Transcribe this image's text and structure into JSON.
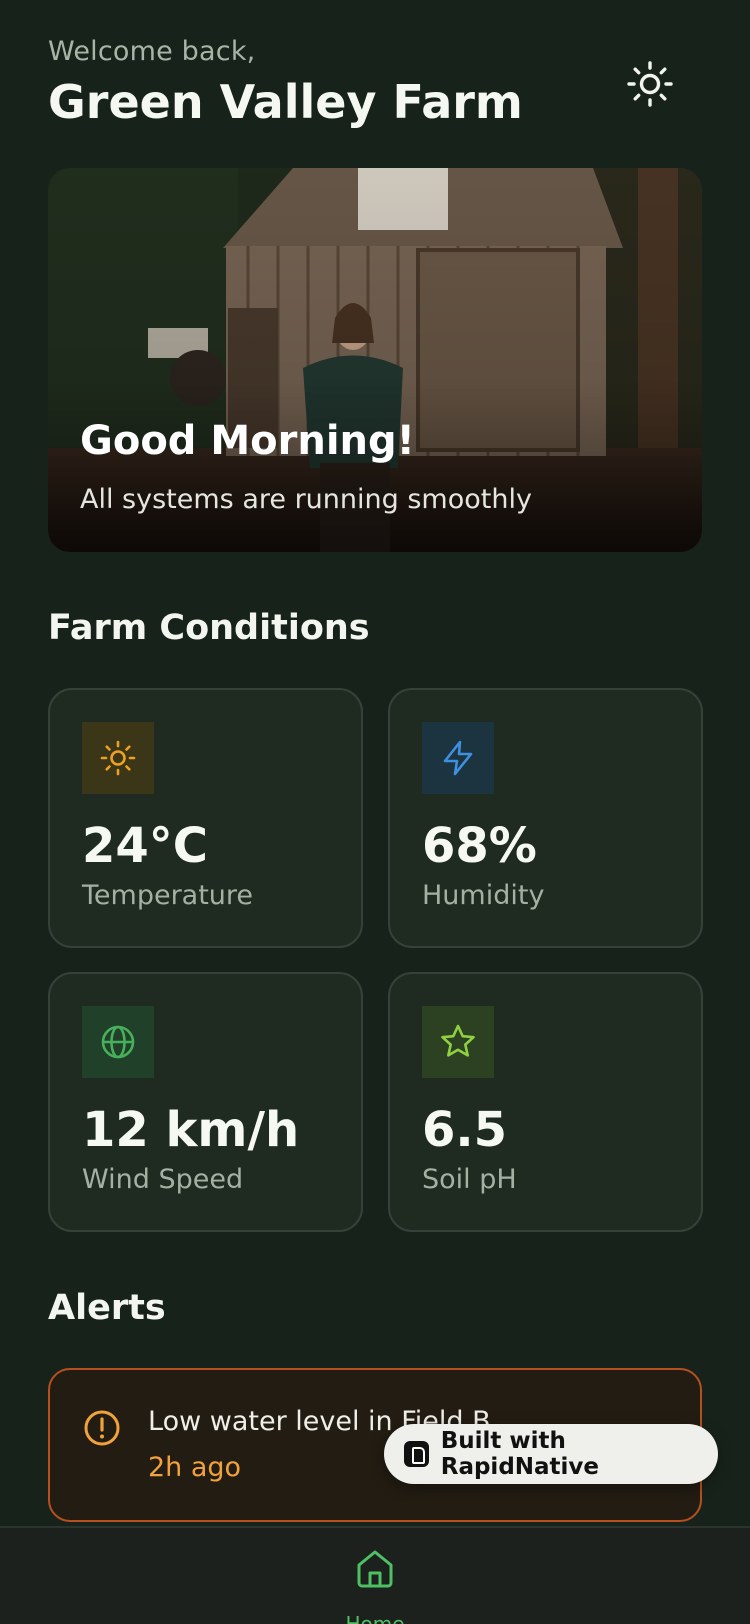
{
  "header": {
    "welcome": "Welcome back,",
    "farm_name": "Green Valley Farm"
  },
  "hero": {
    "title": "Good Morning!",
    "subtitle": "All systems are running smoothly"
  },
  "conditions": {
    "title": "Farm Conditions",
    "cards": [
      {
        "icon": "sun-icon",
        "value": "24°C",
        "label": "Temperature",
        "accent": "#f0a020",
        "tint": "#3a3617"
      },
      {
        "icon": "bolt-icon",
        "value": "68%",
        "label": "Humidity",
        "accent": "#3f8fe0",
        "tint": "#1c3440"
      },
      {
        "icon": "globe-icon",
        "value": "12 km/h",
        "label": "Wind Speed",
        "accent": "#46b05a",
        "tint": "#21402a"
      },
      {
        "icon": "star-icon",
        "value": "6.5",
        "label": "Soil pH",
        "accent": "#8fd040",
        "tint": "#2c4122"
      }
    ]
  },
  "alerts": {
    "title": "Alerts",
    "items": [
      {
        "text": "Low water level in Field B",
        "time": "2h ago",
        "accent": "#f2a23b"
      }
    ]
  },
  "badge": {
    "text": "Built with RapidNative"
  },
  "tabbar": {
    "home_label": "Home",
    "active_color": "#4fbf63"
  }
}
